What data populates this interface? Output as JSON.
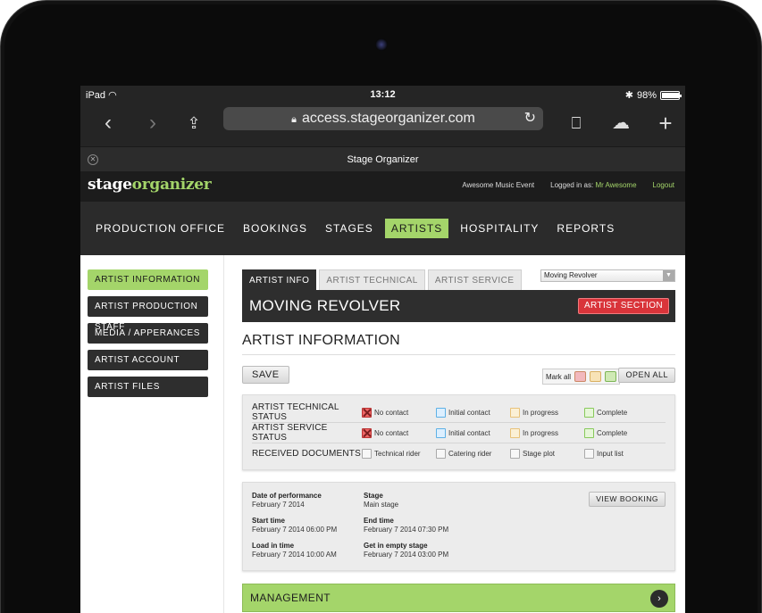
{
  "status": {
    "device": "iPad",
    "time": "13:12",
    "battery": "98%"
  },
  "safari": {
    "url": "access.stageorganizer.com",
    "tab_title": "Stage Organizer"
  },
  "app": {
    "logo_part1": "stage",
    "logo_part2": "organizer",
    "event": "Awesome Music Event",
    "logged_label": "Logged in as:",
    "user": "Mr Awesome",
    "logout": "Logout"
  },
  "nav": [
    "PRODUCTION OFFICE",
    "BOOKINGS",
    "STAGES",
    "ARTISTS",
    "HOSPITALITY",
    "REPORTS"
  ],
  "sidebar": [
    "ARTIST INFORMATION",
    "ARTIST PRODUCTION STAFF",
    "MEDIA / APPERANCES",
    "ARTIST ACCOUNT",
    "ARTIST FILES"
  ],
  "tabs": [
    "ARTIST INFO",
    "ARTIST TECHNICAL",
    "ARTIST SERVICE"
  ],
  "artist_select": "Moving Revolver",
  "artist_name": "MOVING REVOLVER",
  "artist_section": "ARTIST SECTION",
  "section_title": "ARTIST INFORMATION",
  "save": "SAVE",
  "mark_all": "Mark all",
  "open_all": "OPEN ALL",
  "status_rows": [
    {
      "label": "ARTIST TECHNICAL STATUS",
      "options": [
        "No contact",
        "Initial contact",
        "In progress",
        "Complete"
      ]
    },
    {
      "label": "ARTIST SERVICE STATUS",
      "options": [
        "No contact",
        "Initial contact",
        "In progress",
        "Complete"
      ]
    },
    {
      "label": "RECEIVED DOCUMENTS",
      "options": [
        "Technical rider",
        "Catering rider",
        "Stage plot",
        "Input list"
      ]
    }
  ],
  "details": {
    "date_k": "Date of performance",
    "date_v": "February 7 2014",
    "stage_k": "Stage",
    "stage_v": "Main stage",
    "start_k": "Start time",
    "start_v": "February 7 2014 06:00 PM",
    "end_k": "End time",
    "end_v": "February 7 2014 07:30 PM",
    "loadin_k": "Load in time",
    "loadin_v": "February 7 2014 10:00 AM",
    "getin_k": "Get in empty stage",
    "getin_v": "February 7 2014 03:00 PM",
    "view_booking": "VIEW BOOKING"
  },
  "management": "MANAGEMENT",
  "colors": {
    "accent": "#a4d56a",
    "danger": "#d9343a",
    "dark": "#2e2e2e"
  }
}
